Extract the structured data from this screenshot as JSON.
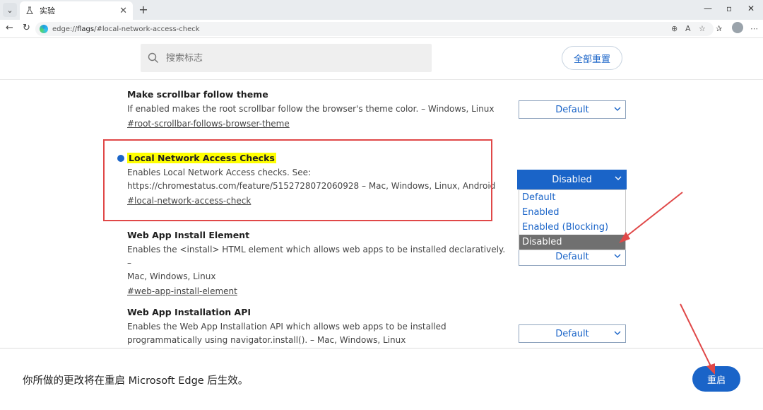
{
  "browser": {
    "tab_title": "实验",
    "tab_close": "✕",
    "new_tab": "+",
    "url_scheme": "edge://",
    "url_path": "flags",
    "url_rest": "/#local-network-access-check",
    "icons": [
      "tab-list-icon",
      "flask-icon",
      "back-icon",
      "refresh-icon",
      "zoom-icon",
      "read-aloud-icon",
      "favorite-icon",
      "favorites-icon",
      "profile-icon",
      "menu-icon"
    ]
  },
  "header": {
    "search_placeholder": "搜索标志",
    "reset_all_label": "全部重置"
  },
  "flags": [
    {
      "title": "Make scrollbar follow theme",
      "description": "If enabled makes the root scrollbar follow the browser's theme color. – Windows, Linux",
      "link": "#root-scrollbar-follows-browser-theme",
      "value": "Default"
    },
    {
      "title": "Local Network Access Checks",
      "description_line1": "Enables Local Network Access checks. See:",
      "description_line2": "https://chromestatus.com/feature/5152728072060928 – Mac, Windows, Linux, Android",
      "link": "#local-network-access-check",
      "value": "Disabled",
      "options": [
        "Default",
        "Enabled",
        "Enabled (Blocking)",
        "Disabled"
      ],
      "underlying_value": "Default"
    },
    {
      "title": "Web App Install Element",
      "description_line1": "Enables the <install> HTML element which allows web apps to be installed declaratively. –",
      "description_line2": "Mac, Windows, Linux",
      "link": "#web-app-install-element"
    },
    {
      "title": "Web App Installation API",
      "description_line1": "Enables the Web App Installation API which allows web apps to be installed",
      "description_line2": "programmatically using navigator.install(). – Mac, Windows, Linux",
      "value": "Default"
    }
  ],
  "footer": {
    "message": "你所做的更改将在重启 Microsoft Edge 后生效。",
    "restart_label": "重启"
  },
  "colors": {
    "accent": "#1a64c8",
    "highlight": "#ffff00",
    "annotation_red": "#e04848"
  }
}
